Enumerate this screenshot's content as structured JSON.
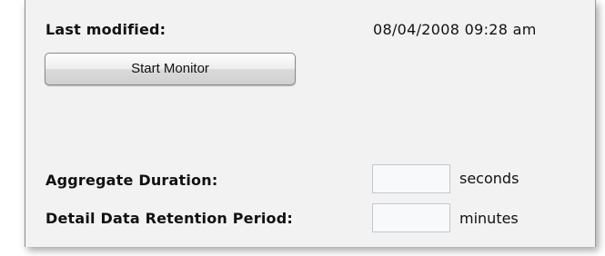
{
  "monitor": {
    "last_modified_label": "Last modified:",
    "last_modified_value": "08/04/2008 09:28 am",
    "start_button_label": "Start Monitor"
  },
  "settings": {
    "aggregate_duration_label": "Aggregate Duration:",
    "aggregate_duration_value": "",
    "aggregate_duration_unit": "seconds",
    "retention_period_label": "Detail Data Retention Period:",
    "retention_period_value": "",
    "retention_period_unit": "minutes"
  }
}
